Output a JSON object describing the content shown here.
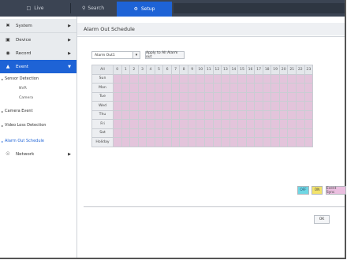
{
  "topbar": {
    "tabs": [
      {
        "label": "Live",
        "icon": "monitor-icon"
      },
      {
        "label": "Search",
        "icon": "search-icon"
      },
      {
        "label": "Setup",
        "icon": "gear-icon"
      }
    ],
    "active_tab": "Setup",
    "accent": "#1e63d6"
  },
  "sidebar": {
    "items": [
      {
        "label": "System",
        "icon": "wrench-icon"
      },
      {
        "label": "Device",
        "icon": "camera-icon"
      },
      {
        "label": "Record",
        "icon": "record-icon"
      },
      {
        "label": "Event",
        "icon": "event-icon"
      }
    ],
    "event_subs": [
      {
        "label": "Sensor Detection"
      },
      {
        "label": "NVR"
      },
      {
        "label": "Camera"
      },
      {
        "label": "Camera Event"
      },
      {
        "label": "Video Loss Detection"
      },
      {
        "label": "Alarm Out Schedule"
      }
    ],
    "network": {
      "label": "Network",
      "icon": "network-icon"
    }
  },
  "content": {
    "title": "Alarm Out Schedule",
    "alarm_select": "Alarm Out1",
    "apply_all_label": "Apply to All Alarm out",
    "grid": {
      "corner": "All",
      "hours": [
        "0",
        "1",
        "2",
        "3",
        "4",
        "5",
        "6",
        "7",
        "8",
        "9",
        "10",
        "11",
        "12",
        "13",
        "14",
        "15",
        "16",
        "17",
        "18",
        "19",
        "20",
        "21",
        "22",
        "23"
      ],
      "days": [
        "Sun",
        "Mon",
        "Tue",
        "Wed",
        "Thu",
        "Fri",
        "Sat",
        "Holiday"
      ],
      "cell_state": "Event Sync",
      "cell_color": "#e3c4db"
    },
    "legend": {
      "off": "OFF",
      "on": "ON",
      "sync": "Event Sync"
    },
    "ok_label": "OK"
  }
}
